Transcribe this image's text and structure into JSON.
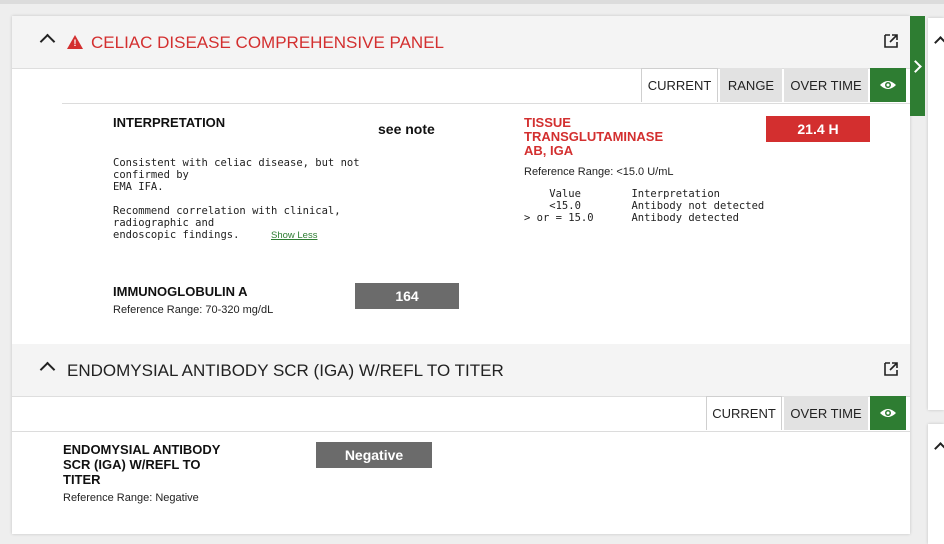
{
  "panel1": {
    "title": "CELIAC DISEASE COMPREHENSIVE PANEL",
    "tabs": {
      "current": "CURRENT",
      "range": "RANGE",
      "over_time": "OVER TIME"
    },
    "interpretation": {
      "label": "INTERPRETATION",
      "value": "see note",
      "note": "Consistent with celiac disease, but not\nconfirmed by\nEMA IFA.\n\nRecommend correlation with clinical,\nradiographic and\nendoscopic findings.",
      "show_less": "Show Less"
    },
    "ttg": {
      "label_line1": "TISSUE",
      "label_line2": "TRANSGLUTAMINASE",
      "label_line3": "AB, IGA",
      "value": "21.4 H",
      "reference": "Reference Range: <15.0 U/mL",
      "table": "    Value        Interpretation\n    <15.0        Antibody not detected\n> or = 15.0      Antibody detected"
    },
    "iga": {
      "label": "IMMUNOGLOBULIN A",
      "value": "164",
      "reference": "Reference Range: 70-320 mg/dL"
    }
  },
  "panel2": {
    "title": "ENDOMYSIAL ANTIBODY SCR (IGA) W/REFL TO TITER",
    "tabs": {
      "current": "CURRENT",
      "over_time": "OVER TIME"
    },
    "result": {
      "label_line1": "ENDOMYSIAL ANTIBODY",
      "label_line2": "SCR (IGA) W/REFL TO",
      "label_line3": "TITER",
      "value": "Negative",
      "reference": "Reference Range: Negative"
    }
  },
  "colors": {
    "abnormal_red": "#d32f2f",
    "eye_green": "#2e7d32",
    "normal_gray": "#6b6b6b"
  },
  "icons": [
    "chevron-up-icon",
    "warning-icon",
    "external-link-icon",
    "eye-icon",
    "chevron-right-icon"
  ]
}
